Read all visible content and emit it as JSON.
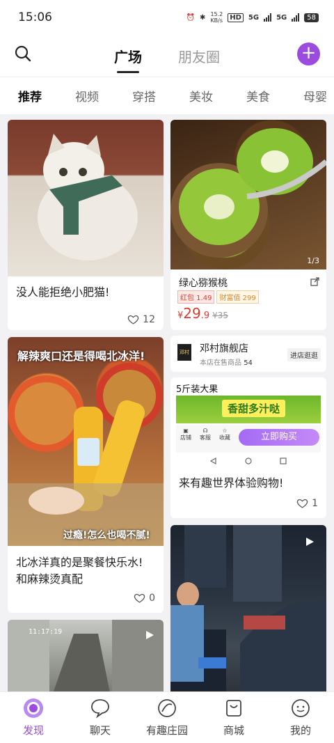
{
  "status": {
    "time": "15:06",
    "net_speed": "15.2",
    "net_unit": "KB/s",
    "hd": "HD",
    "sig1": "5G",
    "sig2": "5G",
    "battery": "58"
  },
  "top_tabs": [
    "广场",
    "朋友圈"
  ],
  "categories": [
    "推荐",
    "视频",
    "穿搭",
    "美妆",
    "美食",
    "母婴"
  ],
  "cards": {
    "cat": {
      "title": "没人能拒绝小肥猫!",
      "likes": "12"
    },
    "drink": {
      "overlay_top": "解辣爽口还是得喝北冰洋!",
      "overlay_bottom": "过瘾!怎么也喝不腻!",
      "title_line1": "北冰洋真的是聚餐快乐水!",
      "title_line2": "和麻辣烫真配",
      "likes": "0"
    },
    "alley": {
      "timestamp": "11:17:19"
    },
    "kiwi": {
      "page": "1/3",
      "name": "绿心猕猴桃",
      "tag1": "红包 1.49",
      "tag2": "财富值 299",
      "price_symbol": "¥",
      "price_int": "29",
      "price_dec": ".9",
      "orig_price": "¥35"
    },
    "shop": {
      "logo": "邓村",
      "name": "邓村旗舰店",
      "sub": "本店在售商品",
      "count": "54",
      "btn": "进店逛逛"
    },
    "fruit": {
      "header": "5斤装大果",
      "banner": "香甜多汁哒",
      "store": "店铺",
      "service": "客服",
      "fav": "收藏",
      "buy": "立即购买",
      "title": "来有趣世界体验购物!",
      "likes": "1"
    }
  },
  "tabbar": [
    {
      "label": "发现",
      "icon": "discover-icon"
    },
    {
      "label": "聊天",
      "icon": "chat-icon"
    },
    {
      "label": "有趣庄园",
      "icon": "manor-icon"
    },
    {
      "label": "商城",
      "icon": "bag-icon"
    },
    {
      "label": "我的",
      "icon": "smile-icon"
    }
  ],
  "colors": {
    "accent": "#9b4bde",
    "price": "#e03b2e"
  }
}
